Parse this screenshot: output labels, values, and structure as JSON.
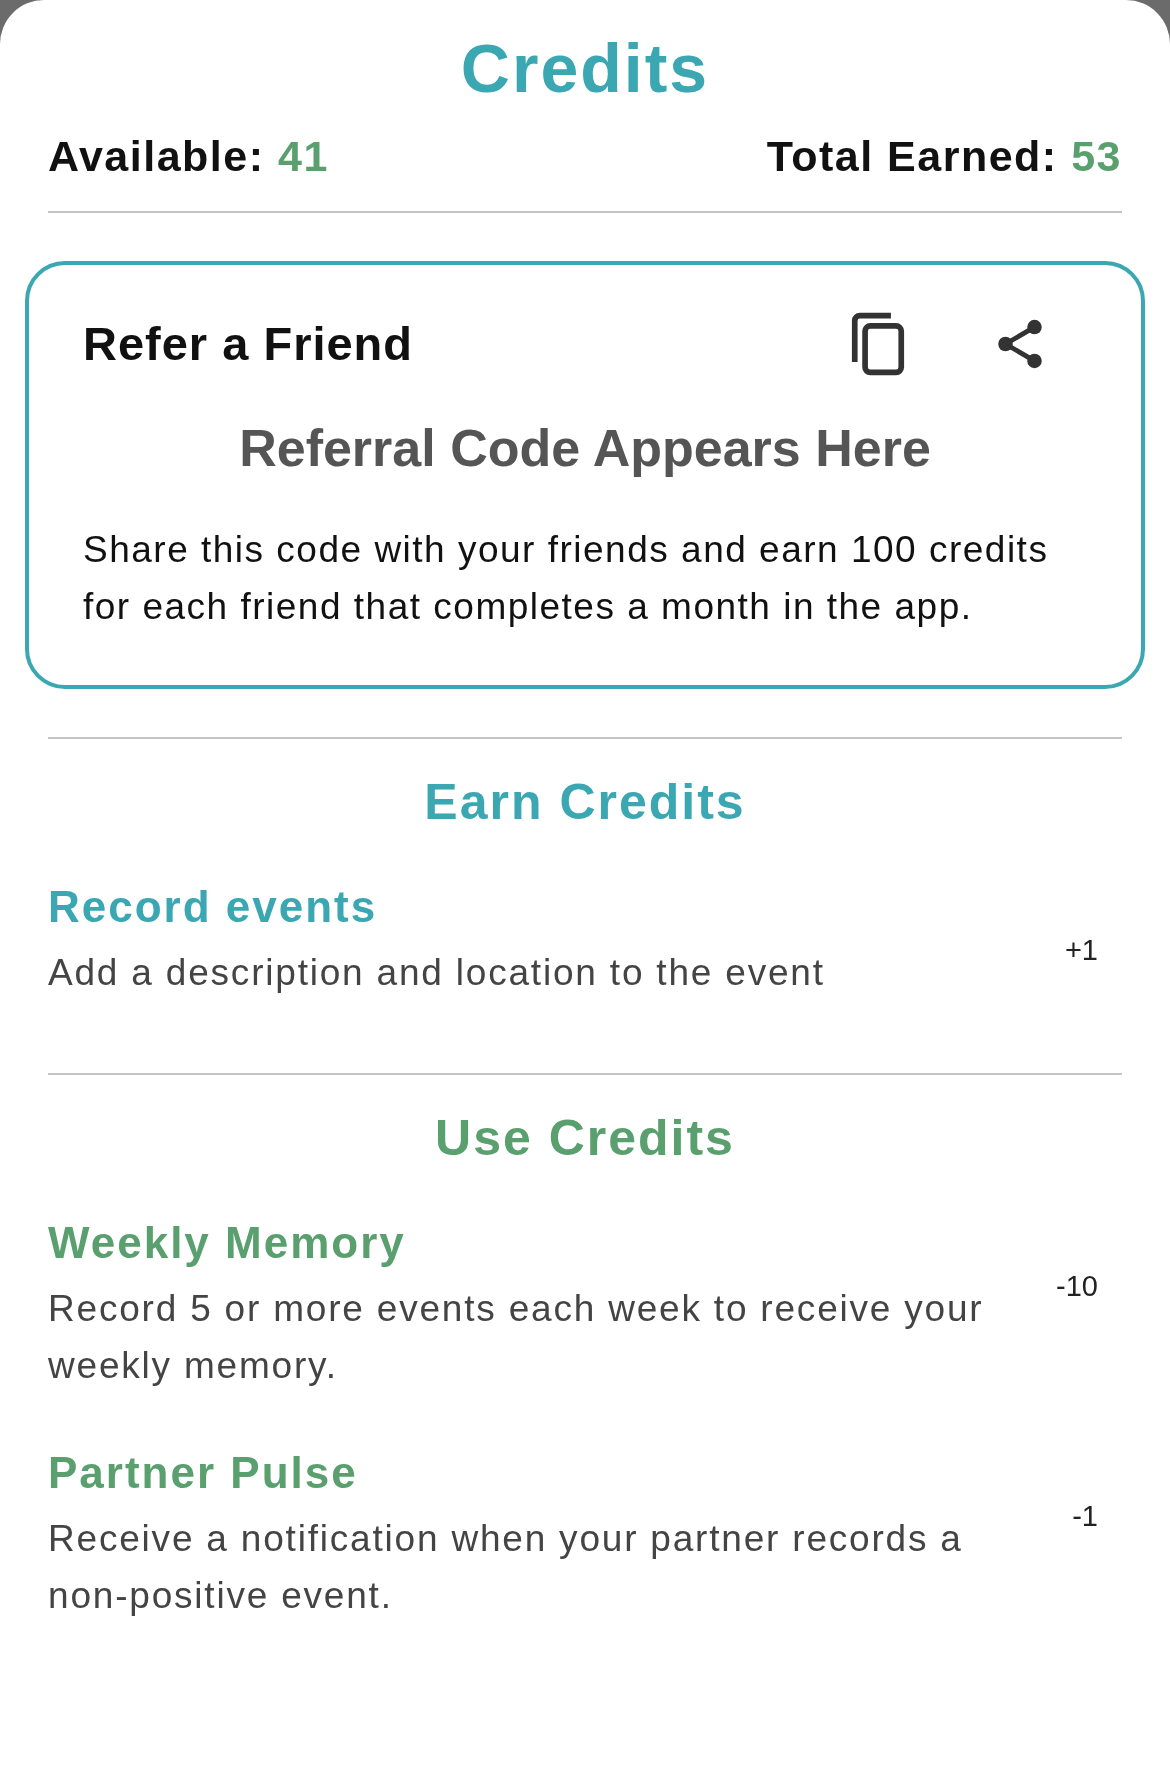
{
  "title": "Credits",
  "stats": [
    {
      "label": "Available:",
      "value": "41"
    },
    {
      "label": "Total Earned:",
      "value": "53"
    }
  ],
  "referral": {
    "title": "Refer a Friend",
    "code": "Referral Code Appears Here",
    "description": "Share this code with your friends and earn 100 credits for each friend that completes a month in the app."
  },
  "sections": [
    {
      "kind": "earn",
      "heading": "Earn Credits",
      "items": [
        {
          "title": "Record events",
          "description": "Add a description and location to the event",
          "amount": "+1"
        }
      ]
    },
    {
      "kind": "use",
      "heading": "Use Credits",
      "items": [
        {
          "title": "Weekly Memory",
          "description": "Record 5 or more events each week to receive your weekly memory.",
          "amount": "-10"
        },
        {
          "title": "Partner Pulse",
          "description": "Receive a notification when your partner records a non-positive event.",
          "amount": "-1"
        }
      ]
    }
  ]
}
